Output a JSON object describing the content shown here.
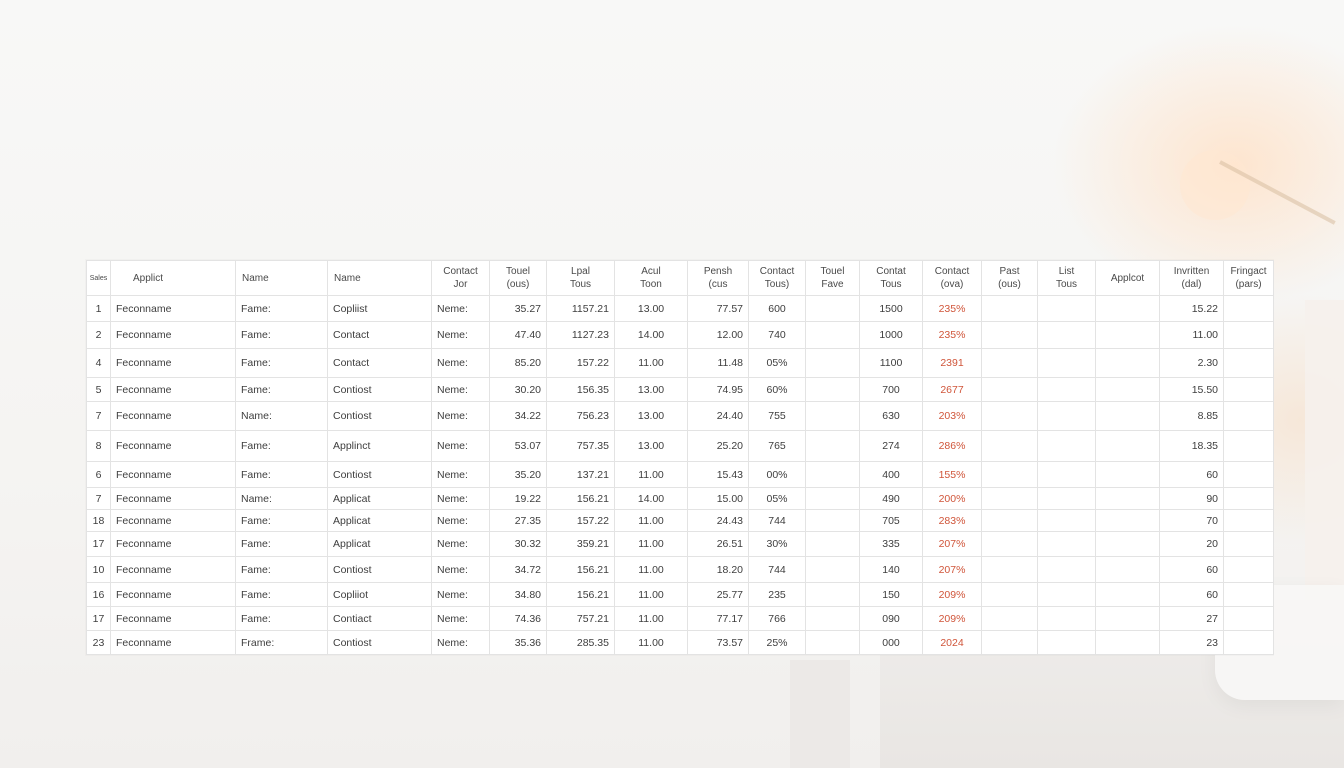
{
  "headers": [
    {
      "line1": "Sales",
      "line2": ""
    },
    {
      "line1": "Applict",
      "line2": ""
    },
    {
      "line1": "Name",
      "line2": ""
    },
    {
      "line1": "Name",
      "line2": ""
    },
    {
      "line1": "Contact",
      "line2": "Jor"
    },
    {
      "line1": "Touel",
      "line2": "(ous)"
    },
    {
      "line1": "Lpal",
      "line2": "Tous"
    },
    {
      "line1": "Acul",
      "line2": "Toon"
    },
    {
      "line1": "Pensh",
      "line2": "(cus"
    },
    {
      "line1": "Contact",
      "line2": "Tous)"
    },
    {
      "line1": "Touel",
      "line2": "Fave"
    },
    {
      "line1": "Contat",
      "line2": "Tous"
    },
    {
      "line1": "Contact",
      "line2": "(ova)"
    },
    {
      "line1": "Past",
      "line2": "(ous)"
    },
    {
      "line1": "List",
      "line2": "Tous"
    },
    {
      "line1": "Applcot",
      "line2": ""
    },
    {
      "line1": "Invritten",
      "line2": "(dal)"
    },
    {
      "line1": "Fringact",
      "line2": "(pars)"
    }
  ],
  "rows": [
    {
      "idx": "1",
      "name": "Feconname",
      "f1": "Fame:",
      "type": "Copliist",
      "label": "Neme:",
      "v1": "35.27",
      "v2": "1157.21",
      "v3": "13.00",
      "v4": "77.57",
      "v5": "600",
      "v6": "",
      "v7": "1500",
      "pct": "235%",
      "v8": "",
      "v9": "",
      "v10": "",
      "v11": "15.22",
      "v12": ""
    },
    {
      "idx": "2",
      "name": "Feconname",
      "f1": "Fame:",
      "type": "Contact",
      "label": "Neme:",
      "v1": "47.40",
      "v2": "1127.23",
      "v3": "14.00",
      "v4": "12.00",
      "v5": "740",
      "v6": "",
      "v7": "1000",
      "pct": "235%",
      "v8": "",
      "v9": "",
      "v10": "",
      "v11": "11.00",
      "v12": ""
    },
    {
      "idx": "4",
      "name": "Feconname",
      "f1": "Fame:",
      "type": "Contact",
      "label": "Neme:",
      "v1": "85.20",
      "v2": "157.22",
      "v3": "11.00",
      "v4": "11.48",
      "v5": "05%",
      "v6": "",
      "v7": "1100",
      "pct": "2391",
      "v8": "",
      "v9": "",
      "v10": "",
      "v11": "2.30",
      "v12": ""
    },
    {
      "idx": "5",
      "name": "Feconname",
      "f1": "Fame:",
      "type": "Contiost",
      "label": "Neme:",
      "v1": "30.20",
      "v2": "156.35",
      "v3": "13.00",
      "v4": "74.95",
      "v5": "60%",
      "v6": "",
      "v7": "700",
      "pct": "2677",
      "v8": "",
      "v9": "",
      "v10": "",
      "v11": "15.50",
      "v12": ""
    },
    {
      "idx": "7",
      "name": "Feconname",
      "f1": "Name:",
      "type": "Contiost",
      "label": "Neme:",
      "v1": "34.22",
      "v2": "756.23",
      "v3": "13.00",
      "v4": "24.40",
      "v5": "755",
      "v6": "",
      "v7": "630",
      "pct": "203%",
      "v8": "",
      "v9": "",
      "v10": "",
      "v11": "8.85",
      "v12": ""
    },
    {
      "idx": "8",
      "name": "Feconname",
      "f1": "Fame:",
      "type": "Applinct",
      "label": "Neme:",
      "v1": "53.07",
      "v2": "757.35",
      "v3": "13.00",
      "v4": "25.20",
      "v5": "765",
      "v6": "",
      "v7": "274",
      "pct": "286%",
      "v8": "",
      "v9": "",
      "v10": "",
      "v11": "18.35",
      "v12": ""
    },
    {
      "idx": "6",
      "name": "Feconname",
      "f1": "Fame:",
      "type": "Contiost",
      "label": "Neme:",
      "v1": "35.20",
      "v2": "137.21",
      "v3": "11.00",
      "v4": "15.43",
      "v5": "00%",
      "v6": "",
      "v7": "400",
      "pct": "155%",
      "v8": "",
      "v9": "",
      "v10": "",
      "v11": "60",
      "v12": ""
    },
    {
      "idx": "7",
      "name": "Feconname",
      "f1": "Name:",
      "type": "Applicat",
      "label": "Neme:",
      "v1": "19.22",
      "v2": "156.21",
      "v3": "14.00",
      "v4": "15.00",
      "v5": "05%",
      "v6": "",
      "v7": "490",
      "pct": "200%",
      "v8": "",
      "v9": "",
      "v10": "",
      "v11": "90",
      "v12": ""
    },
    {
      "idx": "18",
      "name": "Feconname",
      "f1": "Fame:",
      "type": "Applicat",
      "label": "Neme:",
      "v1": "27.35",
      "v2": "157.22",
      "v3": "11.00",
      "v4": "24.43",
      "v5": "744",
      "v6": "",
      "v7": "705",
      "pct": "283%",
      "v8": "",
      "v9": "",
      "v10": "",
      "v11": "70",
      "v12": ""
    },
    {
      "idx": "17",
      "name": "Feconname",
      "f1": "Fame:",
      "type": "Applicat",
      "label": "Neme:",
      "v1": "30.32",
      "v2": "359.21",
      "v3": "11.00",
      "v4": "26.51",
      "v5": "30%",
      "v6": "",
      "v7": "335",
      "pct": "207%",
      "v8": "",
      "v9": "",
      "v10": "",
      "v11": "20",
      "v12": ""
    },
    {
      "idx": "10",
      "name": "Feconname",
      "f1": "Fame:",
      "type": "Contiost",
      "label": "Neme:",
      "v1": "34.72",
      "v2": "156.21",
      "v3": "11.00",
      "v4": "18.20",
      "v5": "744",
      "v6": "",
      "v7": "140",
      "pct": "207%",
      "v8": "",
      "v9": "",
      "v10": "",
      "v11": "60",
      "v12": ""
    },
    {
      "idx": "16",
      "name": "Feconname",
      "f1": "Fame:",
      "type": "Copliiot",
      "label": "Neme:",
      "v1": "34.80",
      "v2": "156.21",
      "v3": "11.00",
      "v4": "25.77",
      "v5": "235",
      "v6": "",
      "v7": "150",
      "pct": "209%",
      "v8": "",
      "v9": "",
      "v10": "",
      "v11": "60",
      "v12": ""
    },
    {
      "idx": "17",
      "name": "Feconname",
      "f1": "Fame:",
      "type": "Contiact",
      "label": "Neme:",
      "v1": "74.36",
      "v2": "757.21",
      "v3": "11.00",
      "v4": "77.17",
      "v5": "766",
      "v6": "",
      "v7": "090",
      "pct": "209%",
      "v8": "",
      "v9": "",
      "v10": "",
      "v11": "27",
      "v12": ""
    },
    {
      "idx": "23",
      "name": "Feconname",
      "f1": "Frame:",
      "type": "Contiost",
      "label": "Neme:",
      "v1": "35.36",
      "v2": "285.35",
      "v3": "11.00",
      "v4": "73.57",
      "v5": "25%",
      "v6": "",
      "v7": "000",
      "pct": "2024",
      "v8": "",
      "v9": "",
      "v10": "",
      "v11": "23",
      "v12": ""
    }
  ],
  "colors": {
    "accent_red": "#d0553a",
    "grid_line": "#e3e3e3"
  }
}
